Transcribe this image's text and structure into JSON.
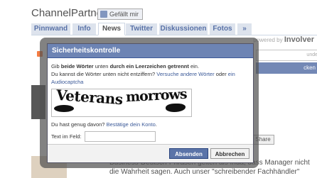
{
  "page": {
    "title": "ChannelPartner",
    "like_label": "Gefällt mir",
    "tabs": [
      "Pinnwand",
      "Info",
      "News",
      "Twitter",
      "Diskussionen",
      "Fotos",
      "»"
    ],
    "powered_prefix": "powered by",
    "powered_brand": "Involver",
    "side_input_text": "unde",
    "side_button_text": "cken",
    "share_label": "Share",
    "news_text": "Business-Deutsch-Phrasen geiten als Inda, dass Manager nicht die Wahrheit sagen. Auch unser \"schreibender Fachhändler\""
  },
  "dialog": {
    "title": "Sicherheitskontrolle",
    "instruction_prefix": "Gib",
    "instruction_bold1": "beide Wörter",
    "instruction_mid": "unten",
    "instruction_bold2": "durch ein Leerzeichen getrennt",
    "instruction_suffix": "ein.",
    "cant_read": "Du kannst die Wörter unten nicht entziffern?",
    "try_other_link": "Versuche andere Wörter",
    "or_text": "oder",
    "audio_link": "ein Audiocaptcha",
    "captcha_word1": "Veterans",
    "captcha_word2": "morrows",
    "fed_up": "Du hast genug davon?",
    "confirm_link": "Bestätige dein Konto",
    "field_label": "Text im Feld:",
    "field_value": "",
    "submit_label": "Absenden",
    "cancel_label": "Abbrechen"
  }
}
